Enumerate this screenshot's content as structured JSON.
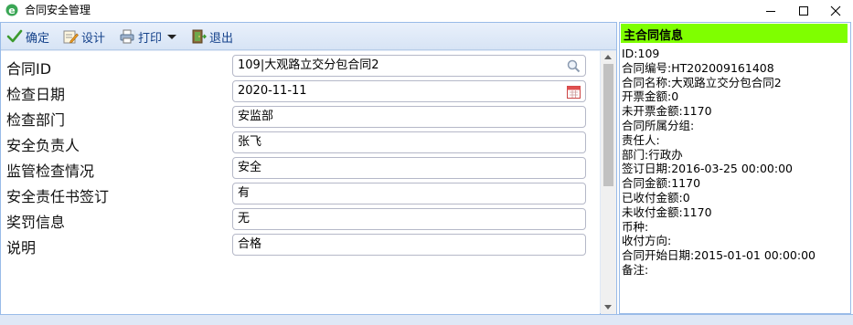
{
  "window": {
    "title": "合同安全管理"
  },
  "toolbar": {
    "confirm_label": "确定",
    "design_label": "设计",
    "print_label": "打印",
    "exit_label": "退出"
  },
  "form": {
    "fields": [
      {
        "label": "合同ID",
        "value": "109|大观路立交分包合同2",
        "icon": "search-icon"
      },
      {
        "label": "检查日期",
        "value": "2020-11-11",
        "icon": "calendar-icon"
      },
      {
        "label": "检查部门",
        "value": "安监部"
      },
      {
        "label": "安全负责人",
        "value": "张飞"
      },
      {
        "label": "监管检查情况",
        "value": "安全"
      },
      {
        "label": "安全责任书签订",
        "value": "有"
      },
      {
        "label": "奖罚信息",
        "value": "无"
      },
      {
        "label": "说明",
        "value": "合格"
      }
    ]
  },
  "info_panel": {
    "header": "主合同信息",
    "lines": [
      "ID:109",
      "合同编号:HT202009161408",
      "合同名称:大观路立交分包合同2",
      "开票金额:0",
      "未开票金额:1170",
      "合同所属分组:",
      "责任人:",
      "部门:行政办",
      "签订日期:2016-03-25 00:00:00",
      "合同金额:1170",
      "已收付金额:0",
      "未收付金额:1170",
      "币种:",
      "收付方向:",
      "合同开始日期:2015-01-01 00:00:00",
      "备注:"
    ],
    "header_color": "#7fff00"
  },
  "colors": {
    "toolbar_text": "#15428b",
    "border": "#99bbe8",
    "pane_bg": "#dfe8f6"
  }
}
